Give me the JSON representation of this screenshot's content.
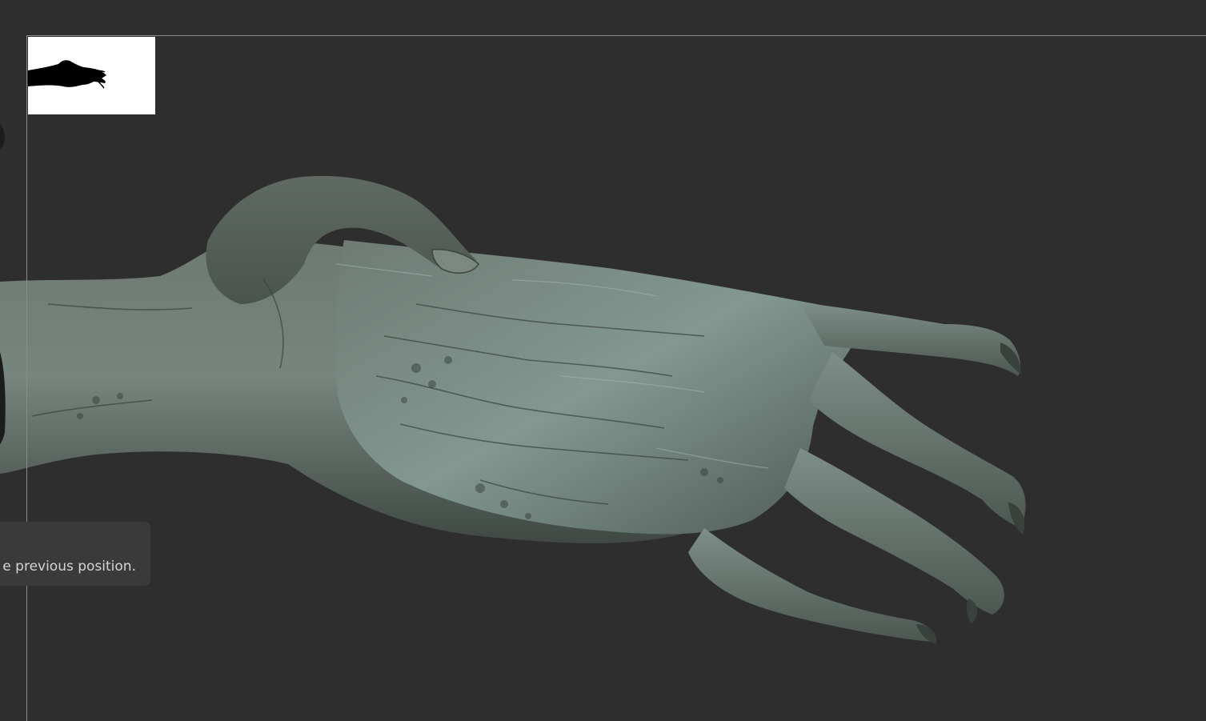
{
  "viewport": {
    "subject": "sculpted creature hand model",
    "background_color": "#2e2e2f",
    "frame_color": "#8a8a8a",
    "skin_color": "#5f6a63",
    "skin_highlight": "#8fa39d",
    "skin_shadow": "#2f3733"
  },
  "navigator": {
    "background": "#ffffff",
    "silhouette_color": "#000000"
  },
  "tooltip": {
    "text": "e previous position."
  }
}
